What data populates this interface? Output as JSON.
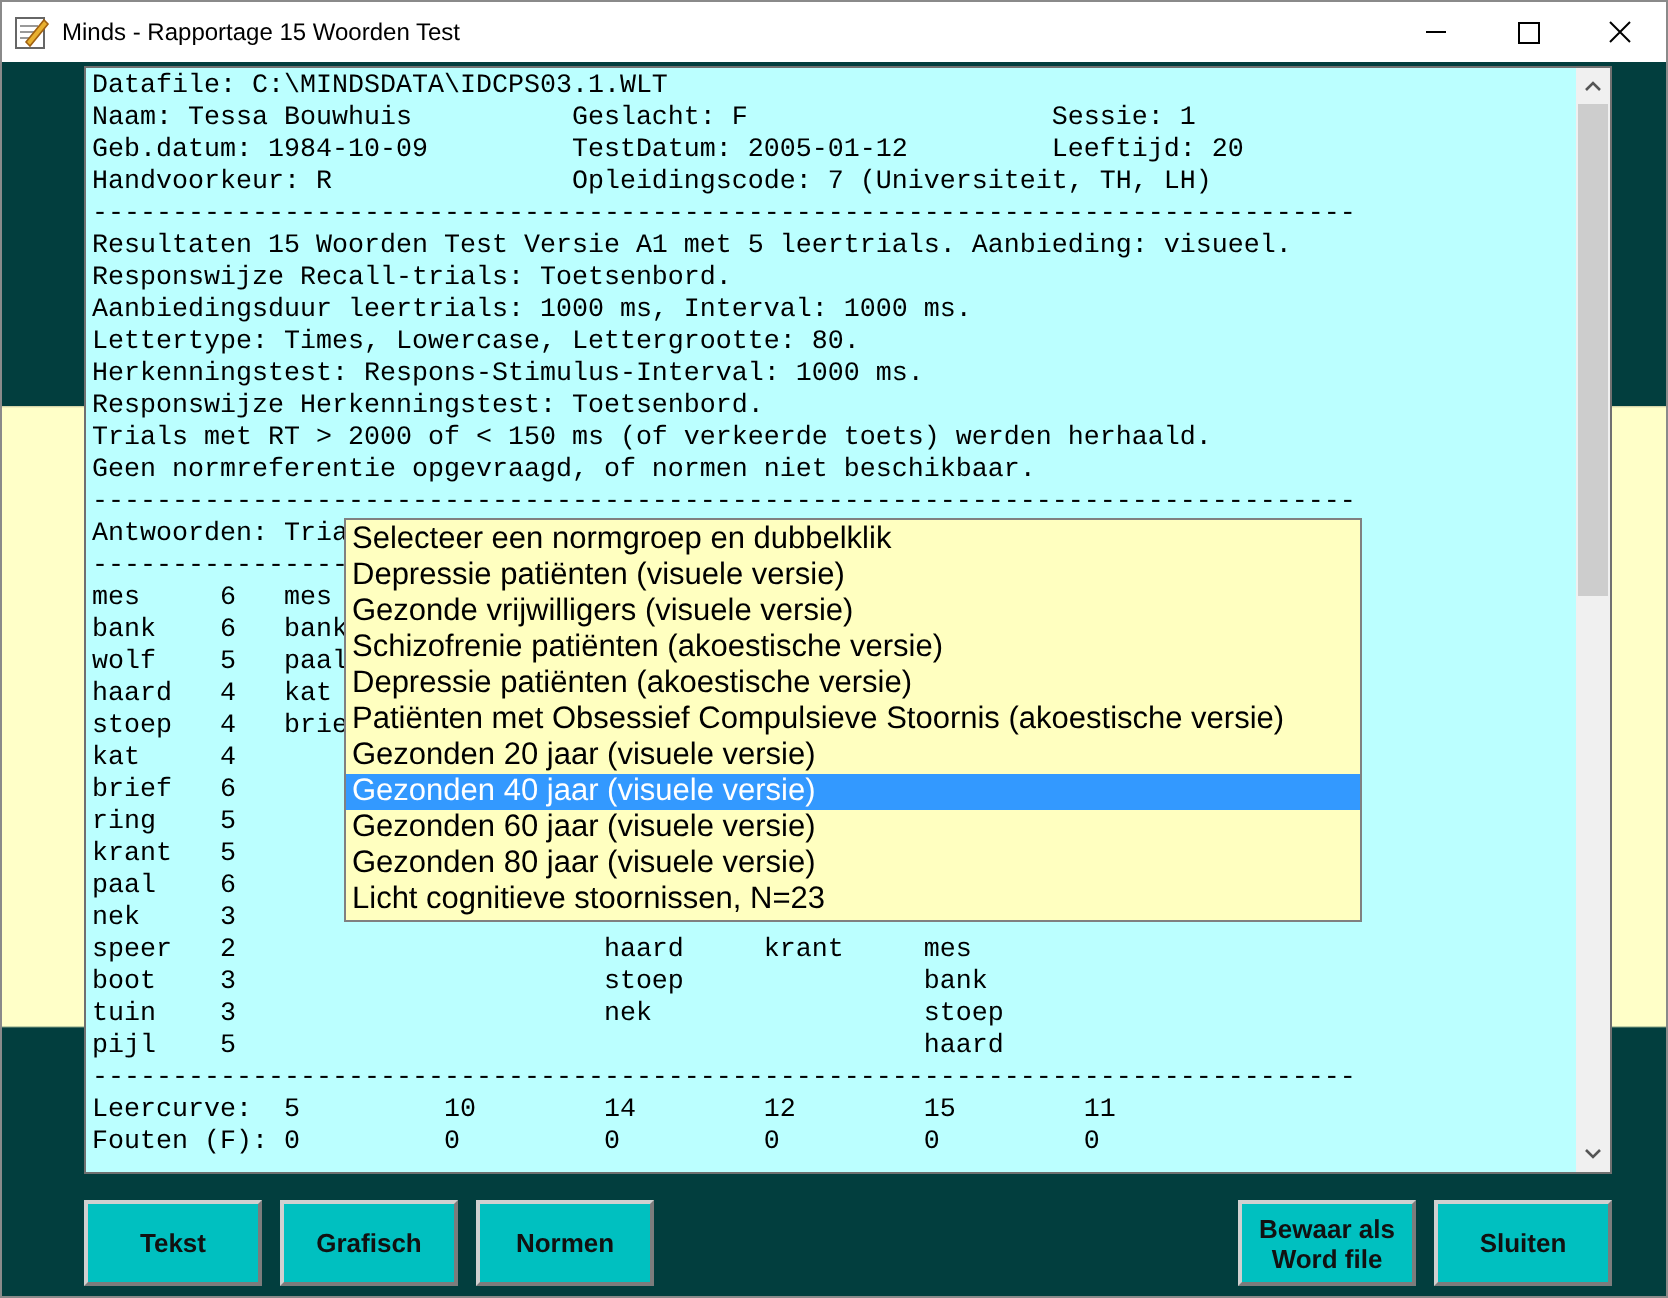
{
  "window": {
    "title": "Minds - Rapportage 15 Woorden Test"
  },
  "report": {
    "lines": [
      "Datafile: C:\\MINDSDATA\\IDCPS03.1.WLT",
      "Naam: Tessa Bouwhuis          Geslacht: F                   Sessie: 1",
      "Geb.datum: 1984-10-09         TestDatum: 2005-01-12         Leeftijd: 20",
      "Handvoorkeur: R               Opleidingscode: 7 (Universiteit, TH, LH)",
      "-------------------------------------------------------------------------------",
      "Resultaten 15 Woorden Test Versie A1 met 5 leertrials. Aanbieding: visueel.",
      "Responswijze Recall-trials: Toetsenbord.",
      "Aanbiedingsduur leertrials: 1000 ms, Interval: 1000 ms.",
      "Lettertype: Times, Lowercase, Lettergrootte: 80.",
      "Herkenningstest: Respons-Stimulus-Interval: 1000 ms.",
      "Responswijze Herkenningstest: Toetsenbord.",
      "Trials met RT > 2000 of < 150 ms (of verkeerde toets) werden herhaald.",
      "Geen normreferentie opgevraagd, of normen niet beschikbaar.",
      "-------------------------------------------------------------------------------",
      "Antwoorden: Tria",
      "----------------",
      "mes     6   mes",
      "bank    6   bank",
      "wolf    5   paal",
      "haard   4   kat",
      "stoep   4   brie",
      "kat     4",
      "brief   6",
      "ring    5",
      "krant   5",
      "paal    6",
      "nek     3",
      "speer   2                       haard     krant     mes",
      "boot    3                       stoep               bank",
      "tuin    3                       nek                 stoep",
      "pijl    5                                           haard",
      "-------------------------------------------------------------------------------",
      "Leercurve:  5         10        14        12        15        11",
      "Fouten (F): 0         0         0         0         0         0"
    ]
  },
  "norm_list": {
    "items": [
      {
        "label": "Selecteer een normgroep en dubbelklik",
        "selected": false
      },
      {
        "label": "Depressie patiënten (visuele versie)",
        "selected": false
      },
      {
        "label": "Gezonde vrijwilligers (visuele versie)",
        "selected": false
      },
      {
        "label": "Schizofrenie patiënten (akoestische versie)",
        "selected": false
      },
      {
        "label": "Depressie patiënten (akoestische versie)",
        "selected": false
      },
      {
        "label": "Patiënten met Obsessief Compulsieve Stoornis (akoestische versie)",
        "selected": false
      },
      {
        "label": "Gezonden 20 jaar (visuele versie)",
        "selected": false
      },
      {
        "label": "Gezonden 40 jaar (visuele versie)",
        "selected": true
      },
      {
        "label": "Gezonden 60 jaar (visuele versie)",
        "selected": false
      },
      {
        "label": "Gezonden 80 jaar (visuele versie)",
        "selected": false
      },
      {
        "label": "Licht cognitieve stoornissen, N=23",
        "selected": false
      }
    ]
  },
  "buttons_left": [
    {
      "label": "Tekst"
    },
    {
      "label": "Grafisch"
    },
    {
      "label": "Normen"
    }
  ],
  "buttons_right": [
    {
      "label": "Bewaar als Word file"
    },
    {
      "label": "Sluiten"
    }
  ]
}
